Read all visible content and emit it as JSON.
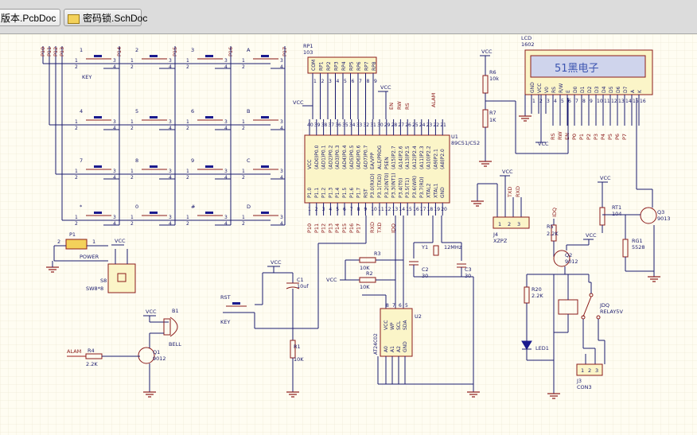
{
  "tabs": [
    {
      "label": "版本.PcbDoc",
      "active": true
    },
    {
      "label": "密码锁.SchDoc",
      "active": false
    }
  ],
  "keypad": {
    "keys": [
      "1",
      "2",
      "3",
      "A",
      "4",
      "5",
      "6",
      "B",
      "7",
      "8",
      "9",
      "C",
      "*",
      "0",
      "#",
      "D"
    ],
    "first_key_label": "KEY",
    "row_nets": [
      "P10",
      "P11",
      "P12",
      "P13"
    ],
    "col_nets": [
      "P14",
      "P15",
      "P16",
      "P17"
    ]
  },
  "rp1": {
    "ref": "RP1",
    "value": "103",
    "pins": [
      "COM",
      "RP1",
      "RP2",
      "RP3",
      "RP4",
      "RP5",
      "RP6",
      "RP7",
      "RP8"
    ],
    "vcc": "VCC"
  },
  "mcu": {
    "ref": "U1",
    "value": "89C51/C52",
    "port0": [
      "(AD0)P0.0",
      "(AD1)P0.1",
      "(AD2)P0.2",
      "(AD3)P0.3",
      "(AD4)P0.4",
      "(AD5)P0.5",
      "(AD6)P0.6",
      "(AD7)P0.7"
    ],
    "port1": [
      "P1.0",
      "P1.1",
      "P1.2",
      "P1.3",
      "P1.4",
      "P1.5",
      "P1.6",
      "P1.7"
    ],
    "port2": [
      "(A15)P2.7",
      "(A14)P2.6",
      "(A13)P2.5",
      "(A12)P2.4",
      "(A11)P2.3",
      "(A10)P2.2",
      "(A9)P2.1",
      "(A8)P2.0"
    ],
    "port3": [
      "P3.0(RXD)",
      "P3.1(TXD)",
      "P3.2(INT0)",
      "P3.3(INT1)",
      "P3.4(T0)",
      "P3.5(T1)",
      "P3.6(WR)",
      "P3.7(RD)"
    ],
    "misc": [
      "VCC",
      "EA/VPP",
      "ALE/PROG",
      "PSEN",
      "RST",
      "XTAL1",
      "XTAL2",
      "GND"
    ],
    "top_nets": [
      "VCC",
      "EN",
      "RW",
      "RS",
      "ALAM"
    ],
    "bottom_nets": [
      "P10",
      "P11",
      "P12",
      "P13",
      "P14",
      "P15",
      "P16",
      "P17",
      "RXD",
      "TXD",
      "IDQ"
    ]
  },
  "lcd": {
    "ref": "LCD",
    "value": "1602",
    "display_text": "51黑电子",
    "pins": [
      "GND",
      "VCC",
      "V0",
      "RS",
      "R/W",
      "E",
      "D0",
      "D1",
      "D2",
      "D3",
      "D4",
      "D5",
      "D6",
      "D7",
      "A",
      "K"
    ],
    "nets": [
      "RS",
      "RW",
      "EN",
      "P0",
      "P1",
      "P2",
      "P3",
      "P4",
      "P5",
      "P6",
      "P7"
    ]
  },
  "r6": {
    "ref": "R6",
    "value": "10k"
  },
  "r7": {
    "ref": "R7",
    "value": "1K"
  },
  "vcc_label": "VCC",
  "j4": {
    "ref": "J4",
    "value": "XZPZ",
    "pins": [
      "1",
      "2",
      "3"
    ],
    "nets": [
      "TXD",
      "RXD"
    ]
  },
  "rt1": {
    "ref": "RT1",
    "value": "104"
  },
  "rg1": {
    "ref": "RG1",
    "value": "5528"
  },
  "q3": {
    "ref": "Q3",
    "value": "9013"
  },
  "r5": {
    "ref": "R5",
    "value": "2.2K",
    "net": "IDQ"
  },
  "q2": {
    "ref": "Q2",
    "value": "9012"
  },
  "r20": {
    "ref": "R20",
    "value": "2.2K"
  },
  "led1": {
    "ref": "LED1"
  },
  "relay": {
    "ref": "JDQ",
    "value": "RELAY5V"
  },
  "j3": {
    "ref": "J3",
    "value": "CON3",
    "pins": [
      "1",
      "2",
      "3"
    ]
  },
  "y1": {
    "ref": "Y1",
    "value": "12MHz"
  },
  "c2": {
    "ref": "C2",
    "value": "30"
  },
  "c3": {
    "ref": "C3",
    "value": "30"
  },
  "r3": {
    "ref": "R3",
    "value": "10K"
  },
  "r2": {
    "ref": "R2",
    "value": "10K"
  },
  "u2": {
    "ref": "U2",
    "value": "AT24C02",
    "pins": [
      "VCC",
      "WP",
      "SCL",
      "SDA",
      "A0",
      "A1",
      "A2",
      "GND"
    ]
  },
  "c1": {
    "ref": "C1",
    "value": "10uf"
  },
  "r1": {
    "ref": "R1",
    "value": "10K"
  },
  "rst": {
    "ref": "RST",
    "value": "KEY"
  },
  "p1": {
    "ref": "P1",
    "value": "POWER",
    "pins": [
      "2",
      "1"
    ]
  },
  "s8": {
    "ref": "S8",
    "value": "SW8*8"
  },
  "b1": {
    "ref": "B1",
    "value": "BELL"
  },
  "q1": {
    "ref": "Q1",
    "value": "9012"
  },
  "r4": {
    "ref": "R4",
    "value": "2.2K",
    "net": "ALAM"
  }
}
